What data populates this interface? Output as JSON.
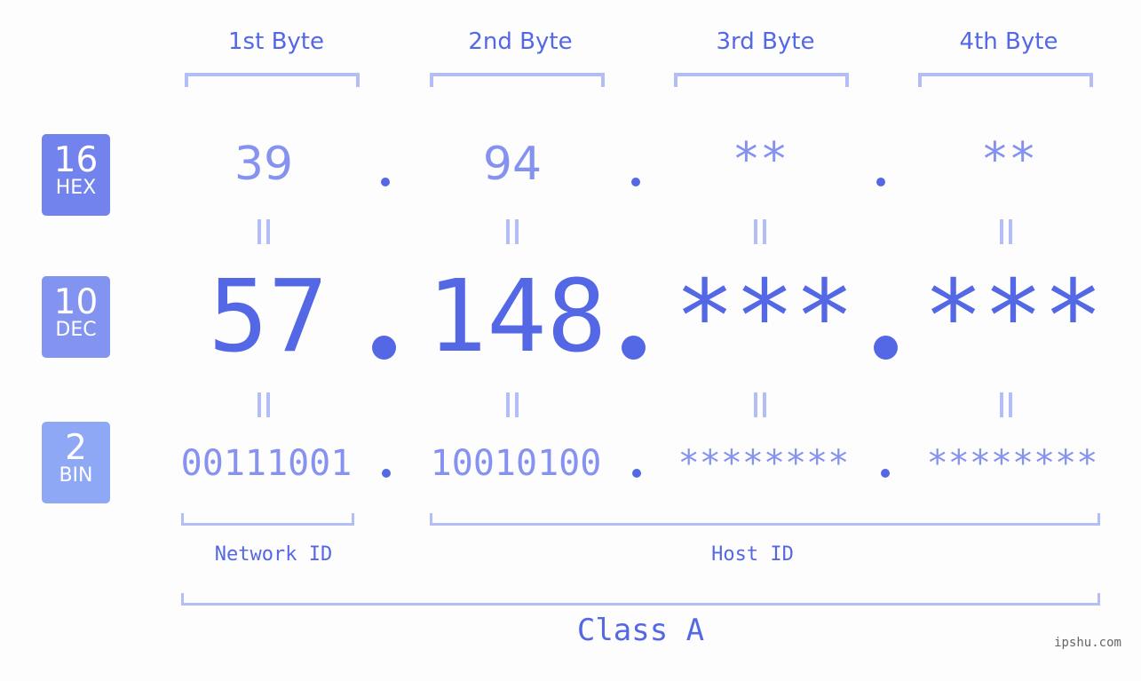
{
  "bytes": {
    "labels": [
      "1st Byte",
      "2nd Byte",
      "3rd Byte",
      "4th Byte"
    ]
  },
  "bases": {
    "hex": {
      "num": "16",
      "unit": "HEX",
      "color": "#7383ed"
    },
    "dec": {
      "num": "10",
      "unit": "DEC",
      "color": "#8293f0"
    },
    "bin": {
      "num": "2",
      "unit": "BIN",
      "color": "#8ea8f5"
    }
  },
  "ip": {
    "hex": [
      "39",
      "94",
      "**",
      "**"
    ],
    "dec": [
      "57",
      "148",
      "***",
      "***"
    ],
    "bin": [
      "00111001",
      "10010100",
      "********",
      "********"
    ]
  },
  "segments": {
    "network_id": "Network ID",
    "host_id": "Host ID",
    "class": "Class A"
  },
  "watermark": "ipshu.com",
  "colors": {
    "primary": "#5468e6",
    "secondary": "#8592ef",
    "bracket": "#b3bdf6",
    "background": "#fcfdfc"
  }
}
